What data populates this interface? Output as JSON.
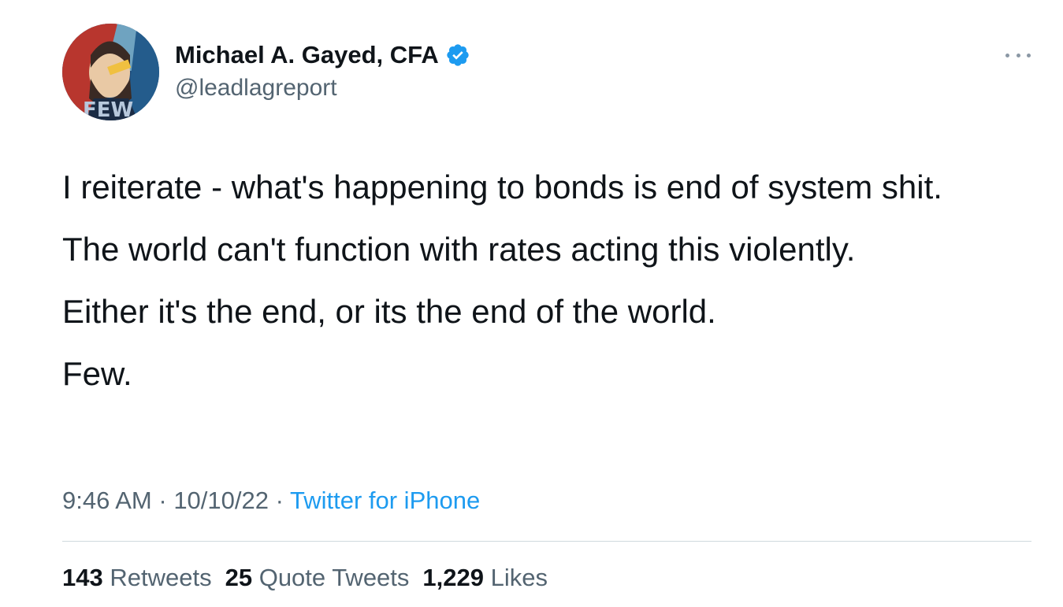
{
  "author": {
    "display_name": "Michael A. Gayed, CFA",
    "handle": "@leadlagreport",
    "verified": true,
    "avatar_text": "FEW"
  },
  "tweet": {
    "paragraphs": [
      "I reiterate - what's happening to bonds is end of system shit.",
      "The world can't function with rates acting this violently.",
      "Either it's the end, or its the end of the world.",
      "Few."
    ],
    "time": "9:46 AM",
    "date": "10/10/22",
    "source": "Twitter for iPhone",
    "separator": " · "
  },
  "stats": {
    "retweets_count": "143",
    "retweets_label": "Retweets",
    "quotes_count": "25",
    "quotes_label": "Quote Tweets",
    "likes_count": "1,229",
    "likes_label": "Likes"
  },
  "icons": {
    "verified": "verified-badge-icon",
    "more": "more-options-icon"
  },
  "colors": {
    "accent": "#1d9bf0",
    "text_primary": "#0f1419",
    "text_secondary": "#536471",
    "divider": "#cfd9de"
  }
}
